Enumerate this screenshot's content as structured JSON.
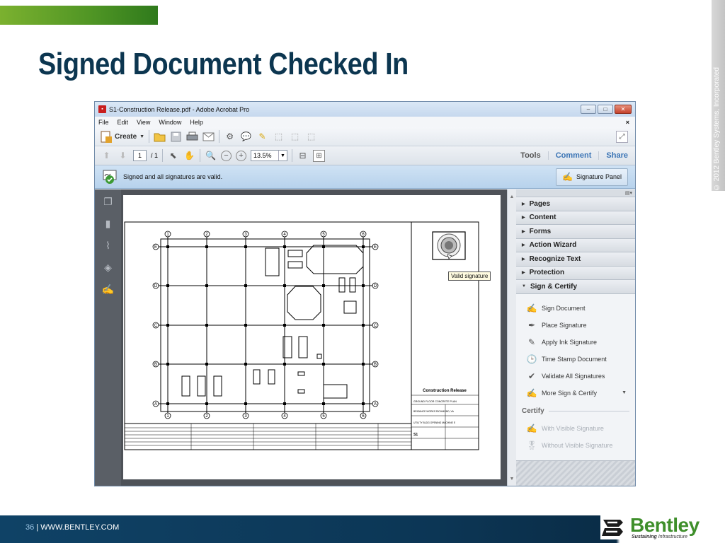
{
  "slide": {
    "title": "Signed Document Checked In",
    "side_copyright": "© 2012 Bentley Systems, Incorporated",
    "footer_page": "36",
    "footer_sep": "| ",
    "footer_site": "WWW.BENTLEY.COM",
    "logo_name": "Bentley",
    "logo_tag_1": "Sustaining",
    "logo_tag_2": " Infrastructure",
    "accent_green": "#4e9424",
    "title_color": "#0c3650"
  },
  "window": {
    "title": "S1-Construction Release.pdf - Adobe Acrobat Pro",
    "controls": {
      "minimize": "–",
      "maximize": "□",
      "close": "✕"
    }
  },
  "menu": {
    "items": [
      "File",
      "Edit",
      "View",
      "Window",
      "Help"
    ],
    "close_doc": "×"
  },
  "toolbar": {
    "create_label": "Create",
    "page_current": "1",
    "page_total": "/ 1",
    "zoom": "13.5%",
    "tabs": [
      "Tools",
      "Comment",
      "Share"
    ]
  },
  "signature_bar": {
    "message": "Signed and all signatures are valid.",
    "panel_button": "Signature Panel"
  },
  "document": {
    "tooltip": "Valid signature",
    "grid_numbers": [
      "1",
      "2",
      "3",
      "4",
      "5",
      "6"
    ],
    "grid_letters": [
      "E",
      "D",
      "C",
      "B",
      "A"
    ],
    "title_block_heading": "Construction Release",
    "title_block_sheet_title": "GROUND FLOOR CONCRETE PLAN",
    "title_block_company": "BRISANCE WORKS\nRICHMOND, VA",
    "title_block_project": "UTILITY BLDG\nOPENING MACHINE E",
    "title_block_sheet": "S1"
  },
  "right_panel": {
    "sections": [
      "Pages",
      "Content",
      "Forms",
      "Action Wizard",
      "Recognize Text",
      "Protection"
    ],
    "open_section": "Sign & Certify",
    "items": [
      "Sign Document",
      "Place Signature",
      "Apply Ink Signature",
      "Time Stamp Document",
      "Validate All Signatures",
      "More Sign & Certify"
    ],
    "certify_label": "Certify",
    "certify_items": [
      "With Visible Signature",
      "Without Visible Signature"
    ]
  }
}
